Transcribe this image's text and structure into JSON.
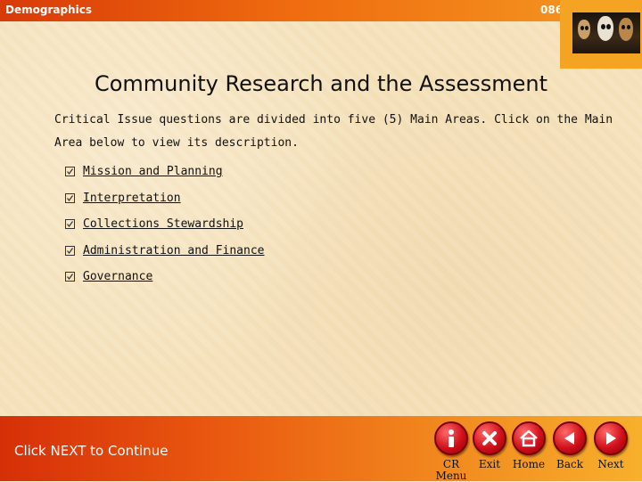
{
  "header": {
    "title": "Demographics",
    "slide_number": "086"
  },
  "main": {
    "heading": "Community Research and the Assessment",
    "intro": "Critical Issue questions are divided into five (5) Main Areas.  Click on the Main Area below to view its description.",
    "areas": [
      {
        "label": "Mission and Planning"
      },
      {
        "label": "Interpretation"
      },
      {
        "label": "Collections Stewardship"
      },
      {
        "label": "Administration and Finance"
      },
      {
        "label": "Governance"
      }
    ]
  },
  "footer": {
    "continue_text": "Click NEXT to Continue",
    "nav": {
      "cr_menu": "CR Menu",
      "exit": "Exit",
      "home": "Home",
      "back": "Back",
      "next": "Next"
    }
  },
  "colors": {
    "accent": "#e84d0e",
    "button": "#d0101a"
  }
}
